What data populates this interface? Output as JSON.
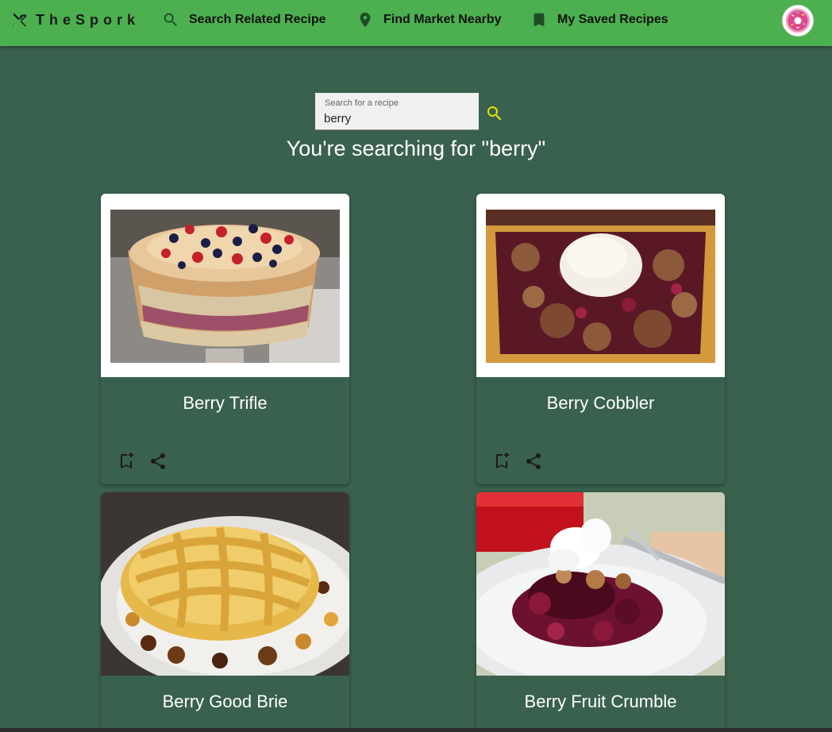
{
  "navbar": {
    "brand": "TheSpork",
    "items": [
      {
        "label": "Search Related Recipe",
        "icon": "search-icon"
      },
      {
        "label": "Find Market Nearby",
        "icon": "location-pin-icon"
      },
      {
        "label": "My Saved Recipes",
        "icon": "bookmark-icon"
      }
    ],
    "avatar_icon": "donut-icon"
  },
  "search": {
    "placeholder": "Search for a recipe",
    "value": "berry",
    "heading": "You're searching for \"berry\""
  },
  "recipes": [
    {
      "title": "Berry Trifle",
      "image": "berry-trifle-photo"
    },
    {
      "title": "Berry Cobbler",
      "image": "berry-cobbler-photo"
    },
    {
      "title": "Berry Good Brie",
      "image": "berry-good-brie-photo"
    },
    {
      "title": "Berry Fruit Crumble",
      "image": "berry-fruit-crumble-photo"
    }
  ],
  "colors": {
    "navbar": "#4caf50",
    "background": "#3a614d",
    "search_icon": "#e8e800",
    "card_text": "#ffffff"
  }
}
